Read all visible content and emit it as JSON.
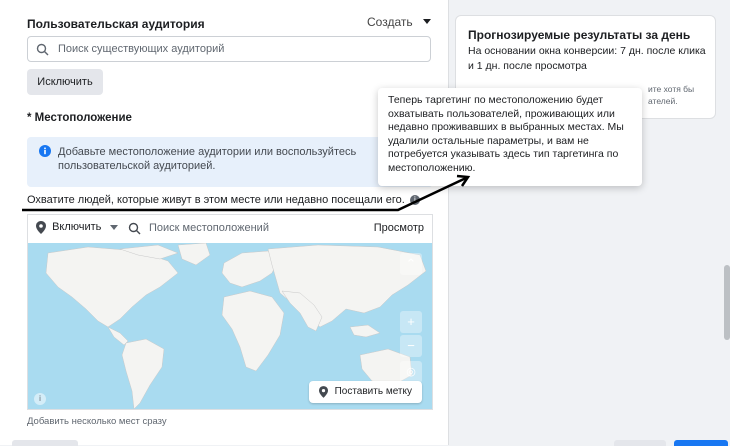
{
  "audience": {
    "title": "Пользовательская аудитория",
    "create_label": "Создать",
    "search_placeholder": "Поиск существующих аудиторий",
    "exclude_label": "Исключить"
  },
  "location": {
    "title": "* Местоположение",
    "info_text": "Добавьте местоположение аудитории или воспользуйтесь пользовательской аудиторией.",
    "reach_text": "Охватите людей, которые живут в этом месте или недавно посещали его.",
    "include_label": "Включить",
    "search_placeholder": "Поиск местоположений",
    "view_label": "Просмотр",
    "pin_label": "Поставить метку",
    "bulk_hint": "Добавить несколько мест сразу"
  },
  "results": {
    "title": "Прогнозируемые результаты за день",
    "subtitle": "На основании окна конверсии: 7 дн. после клика и 1 дн. после просмотра",
    "partial_line1": "ите хотя бы",
    "partial_line2": "ателей."
  },
  "tooltip": {
    "text": "Теперь таргетинг по местоположению будет охватывать пользователей, проживающих или недавно проживавших в выбранных местах. Мы удалили остальные параметры, и вам не потребуется указывать здесь тип таргетинга по местоположению."
  },
  "colors": {
    "info_icon": "#1877f2",
    "primary_button": "#1877f2",
    "map_water": "#a9dbf0",
    "map_land": "#f4f4f2"
  }
}
